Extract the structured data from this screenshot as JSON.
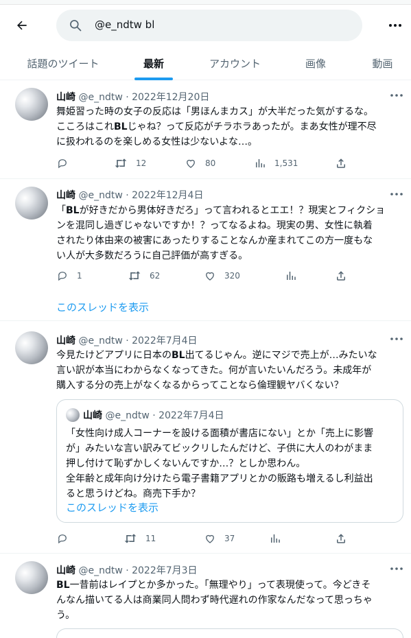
{
  "search": {
    "query": "@e_ndtw bl"
  },
  "tabs": [
    {
      "label": "話題のツイート"
    },
    {
      "label": "最新"
    },
    {
      "label": "アカウント"
    },
    {
      "label": "画像"
    },
    {
      "label": "動画"
    }
  ],
  "tweets": [
    {
      "name": "山崎",
      "meta": "@e_ndtw · 2022年12月20日",
      "text": [
        "舞姫習った時の女子の反応は「男ほんまカス」が大半だった気がするな。",
        "こころはこれ",
        "BL",
        "じゃね？って反応がチラホラあったが。まあ女性が理不尽",
        "に扱われるのを楽しめる女性は少ないよな…。"
      ],
      "replies": "",
      "retweets": "12",
      "likes": "80",
      "views": "1,531"
    },
    {
      "name": "山崎",
      "meta": "@e_ndtw · 2022年12月4日",
      "text": [
        "「",
        "BL",
        "が好きだから男体好きだろ」って言われるとエエ！？現実とフィクショ",
        "ンを混同し過ぎじゃないですか！？ってなるよね。現実の男、女性に執着",
        "されたり体由来の被害にあったりすることなんか産まれてこの方一度もな",
        "い人が大多数だろうに自己評価が高すぎる。"
      ],
      "replies": "1",
      "retweets": "62",
      "likes": "320",
      "views": "",
      "thread_link": "このスレッドを表示"
    },
    {
      "name": "山崎",
      "meta": "@e_ndtw · 2022年7月4日",
      "text": [
        "今見たけどアプリに日本の",
        "BL",
        "出てるじゃん。逆にマジで売上が…みたいな",
        "言い訳が本当にわからなくなってきた。何が言いたいんだろう。未成年が",
        "購入する分の売上がなくなるからってことなら倫理観ヤバくない？"
      ],
      "quote": {
        "name": "山崎",
        "meta": "@e_ndtw · 2022年7月4日",
        "text": [
          "「女性向け成人コーナーを設ける面積が書店にない」とか「売上に影響",
          "が」みたいな言い訳みてビックリしたんだけど、子供に大人のわがまま",
          "押し付けて恥ずかしくないんですか…？としか思わん。",
          "全年齢と成年向け分けたら電子書籍アプリとかの販路も増えるし利益出",
          "ると思うけどね。商売下手か？"
        ],
        "thread_link": "このスレッドを表示"
      },
      "replies": "",
      "retweets": "11",
      "likes": "37",
      "views": ""
    },
    {
      "name": "山崎",
      "meta": "@e_ndtw · 2022年7月3日",
      "text": [
        "BL",
        "一昔前はレイプとか多かった。「無理やり」って表現使って。今どきそ",
        "んなん描いてる人は商業同人問わず時代遅れの作家なんだなって思っちゃ",
        "う。"
      ]
    }
  ],
  "icons": {
    "back": "back-arrow-icon",
    "search": "search-icon",
    "more": "more-dots-icon",
    "reply": "reply-icon",
    "retweet": "retweet-icon",
    "like": "heart-icon",
    "views": "views-bar-icon",
    "share": "share-icon"
  },
  "colors": {
    "accent": "#1d9bf0",
    "secondary_text": "#536471",
    "primary_text": "#0f1419"
  }
}
